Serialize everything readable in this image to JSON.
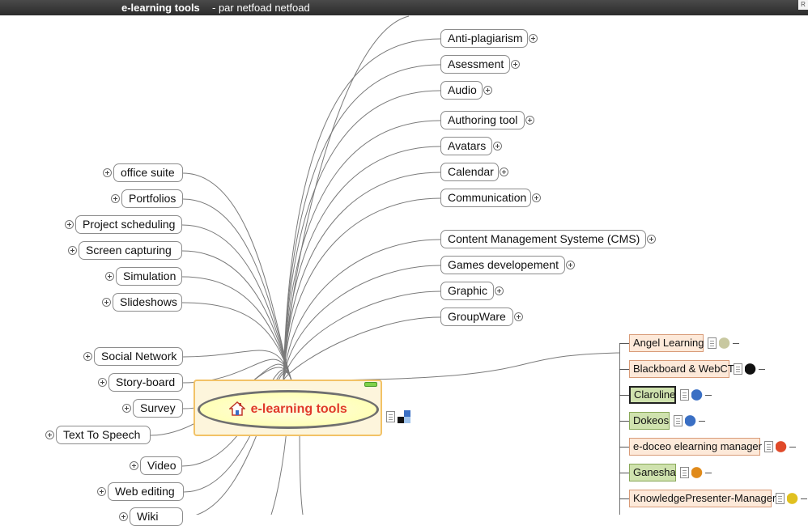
{
  "window": {
    "app_title": "e-learning tools",
    "author": "- par netfoad netfoad",
    "corner_stub": "R"
  },
  "root": {
    "label": "e-learning tools"
  },
  "right_nodes": [
    {
      "label": "Anti-plagiarism"
    },
    {
      "label": "Asessment"
    },
    {
      "label": "Audio"
    },
    {
      "label": "Authoring tool"
    },
    {
      "label": "Avatars"
    },
    {
      "label": "Calendar"
    },
    {
      "label": "Communication"
    },
    {
      "label": "Content Management Systeme (CMS)"
    },
    {
      "label": "Games developement"
    },
    {
      "label": "Graphic"
    },
    {
      "label": "GroupWare"
    }
  ],
  "left_nodes": [
    {
      "label": "office suite"
    },
    {
      "label": "Portfolios"
    },
    {
      "label": "Project scheduling"
    },
    {
      "label": "Screen capturing"
    },
    {
      "label": "Simulation"
    },
    {
      "label": "Slideshows"
    },
    {
      "label": "Social Network"
    },
    {
      "label": "Story-board"
    },
    {
      "label": "Survey"
    },
    {
      "label": "Text To Speech"
    },
    {
      "label": "Video"
    },
    {
      "label": "Web editing"
    },
    {
      "label": "Wiki"
    }
  ],
  "platforms": [
    {
      "label": "Angel Learning",
      "style": "orange",
      "icon": "angel-logo-icon"
    },
    {
      "label": "Blackboard & WebCT",
      "style": "orange",
      "icon": "blackboard-logo-icon"
    },
    {
      "label": "Claroline",
      "style": "green-selected",
      "icon": "claroline-logo-icon"
    },
    {
      "label": "Dokeos",
      "style": "green",
      "icon": "dokeos-logo-icon"
    },
    {
      "label": "e-doceo elearning manager",
      "style": "orange",
      "icon": "edoceo-logo-icon"
    },
    {
      "label": "Ganesha",
      "style": "green",
      "icon": "ganesha-logo-icon"
    },
    {
      "label": "KnowledgePresenter-Manager",
      "style": "orange",
      "icon": "knowledgepresenter-logo-icon"
    }
  ],
  "colors": {
    "root_text": "#e03a2a",
    "root_fill": "#ffffb8",
    "root_frame": "#f2c266",
    "open_source_fill": "#cfe2ae",
    "commercial_fill": "#fde9d9"
  }
}
